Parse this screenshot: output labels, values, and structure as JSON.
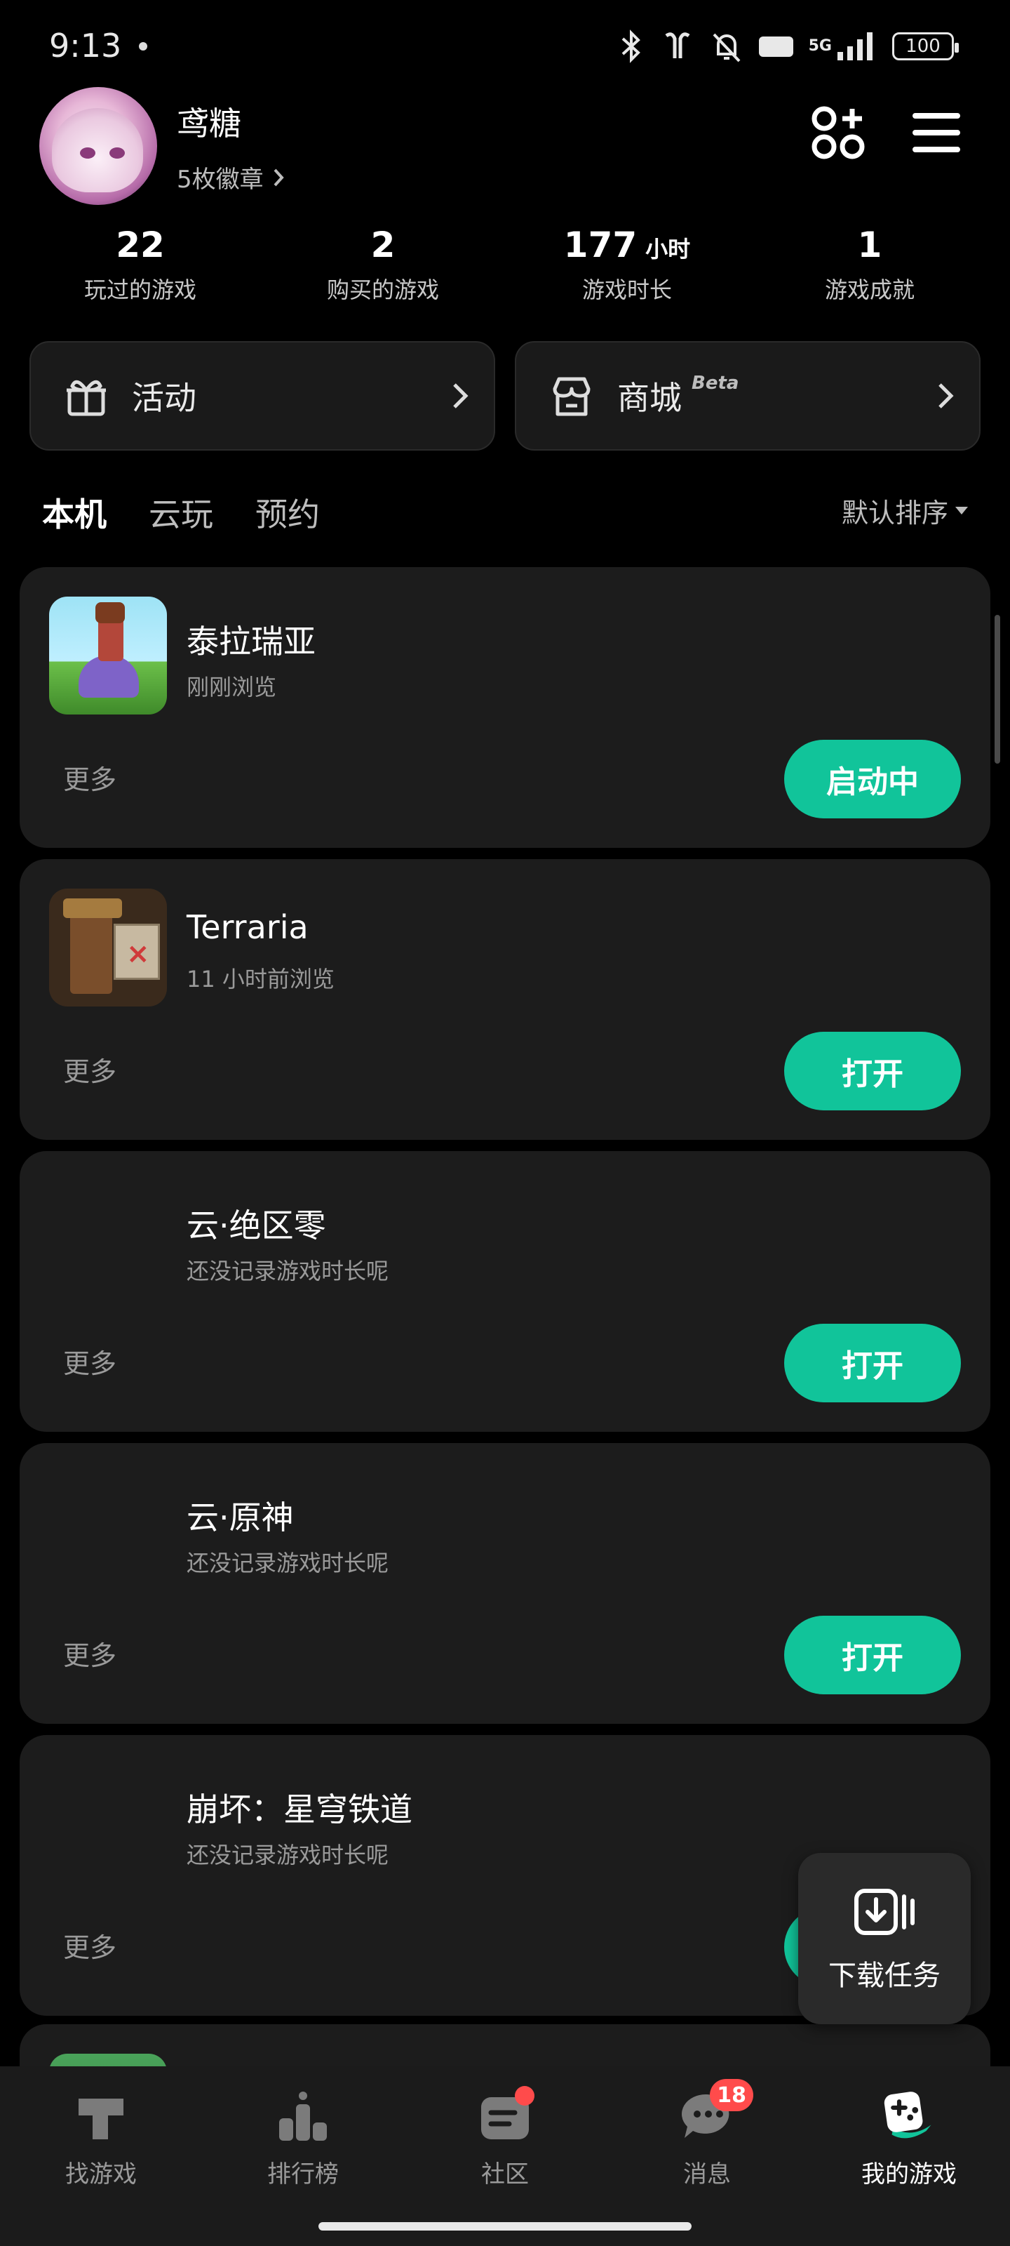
{
  "status_bar": {
    "time": "9:13",
    "network": "5G",
    "battery": "100",
    "hd": "HD"
  },
  "profile": {
    "username": "鸢糖",
    "badges": "5枚徽章"
  },
  "stats": [
    {
      "value": "22",
      "unit": "",
      "label": "玩过的游戏"
    },
    {
      "value": "2",
      "unit": "",
      "label": "购买的游戏"
    },
    {
      "value": "177",
      "unit": "小时",
      "label": "游戏时长"
    },
    {
      "value": "1",
      "unit": "",
      "label": "游戏成就"
    }
  ],
  "actions": {
    "activity": "活动",
    "store": "商城",
    "store_tag": "Beta"
  },
  "tabs": [
    "本机",
    "云玩",
    "预约"
  ],
  "sort": "默认排序",
  "more_label": "更多",
  "games": [
    {
      "name": "泰拉瑞亚",
      "sub": "刚刚浏览",
      "button": "启动中"
    },
    {
      "name": "Terraria",
      "sub": "11 小时前浏览",
      "button": "打开"
    },
    {
      "name": "云·绝区零",
      "sub": "还没记录游戏时长呢",
      "button": "打开"
    },
    {
      "name": "云·原神",
      "sub": "还没记录游戏时长呢",
      "button": "打开"
    },
    {
      "name": "崩坏：星穹铁道",
      "sub": "还没记录游戏时长呢",
      "button": "打开"
    }
  ],
  "float_download": "下载任务",
  "bottom_nav": [
    {
      "label": "找游戏",
      "icon": "find-game-icon"
    },
    {
      "label": "排行榜",
      "icon": "leaderboard-icon"
    },
    {
      "label": "社区",
      "icon": "community-icon"
    },
    {
      "label": "消息",
      "icon": "message-icon",
      "badge": "18"
    },
    {
      "label": "我的游戏",
      "icon": "my-games-icon"
    }
  ],
  "colors": {
    "accent": "#11c49a",
    "card": "#1c1c1c",
    "badge": "#ff4b4b"
  }
}
